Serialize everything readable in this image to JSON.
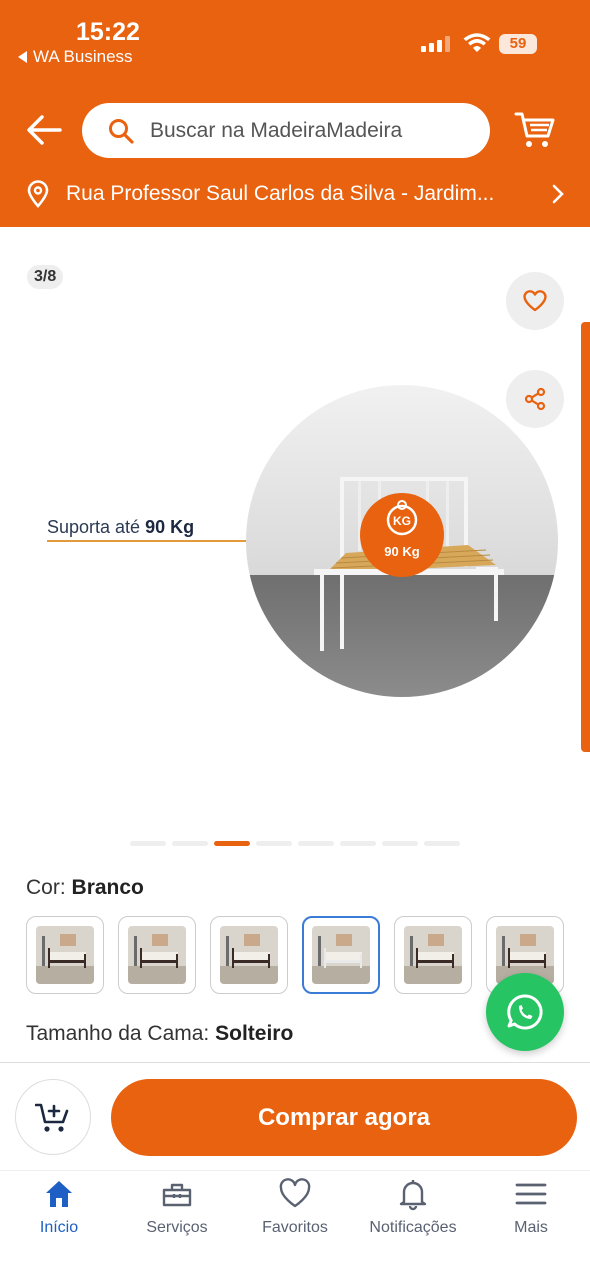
{
  "status_bar": {
    "time": "15:22",
    "back_app": "WA Business",
    "battery": "59"
  },
  "header": {
    "search_placeholder": "Buscar na MadeiraMadeira",
    "address": "Rua Professor Saul Carlos da Silva - Jardim..."
  },
  "gallery": {
    "counter": "3/8",
    "support_prefix": "Suporta até ",
    "support_value": "90 Kg",
    "weight_badge_unit": "KG",
    "weight_badge_value": "90 Kg",
    "total_images": 8,
    "active_index": 3
  },
  "options": {
    "color_label": "Cor:",
    "color_value": "Branco",
    "swatch_count": 6,
    "selected_swatch": 4,
    "size_label": "Tamanho da Cama:",
    "size_value": "Solteiro"
  },
  "actions": {
    "buy_label": "Comprar agora"
  },
  "bottom_nav": {
    "items": [
      {
        "label": "Início",
        "icon": "home-icon",
        "active": true
      },
      {
        "label": "Serviços",
        "icon": "toolbox-icon",
        "active": false
      },
      {
        "label": "Favoritos",
        "icon": "heart-icon",
        "active": false
      },
      {
        "label": "Notificações",
        "icon": "bell-icon",
        "active": false
      },
      {
        "label": "Mais",
        "icon": "menu-icon",
        "active": false
      }
    ]
  },
  "colors": {
    "brand_orange": "#e8620f",
    "active_blue": "#1d5fc4",
    "whatsapp_green": "#27c463"
  }
}
